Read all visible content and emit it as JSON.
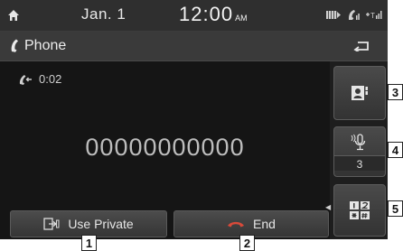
{
  "statusbar": {
    "date": "Jan.  1",
    "time": "12:00",
    "ampm": "AM"
  },
  "titlebar": {
    "title": "Phone"
  },
  "call": {
    "duration": "0:02",
    "number": "00000000000"
  },
  "buttons": {
    "use_private": "Use Private",
    "end": "End"
  },
  "side": {
    "mic_count": "3"
  },
  "callouts": [
    "1",
    "2",
    "3",
    "4",
    "5"
  ],
  "colors": {
    "screen_bg": "#1b1b1b",
    "statusbar_bg": "#2f2f2f",
    "titlebar_bg": "#3a3a3a",
    "text": "#e6e6e6"
  },
  "icons": [
    "home-icon",
    "battery-icon",
    "phone-signal-icon",
    "signal-icon",
    "phone-icon",
    "back-icon",
    "call-timer-icon",
    "private-mode-icon",
    "end-call-icon",
    "contacts-icon",
    "mute-mic-icon",
    "keypad-icon"
  ]
}
